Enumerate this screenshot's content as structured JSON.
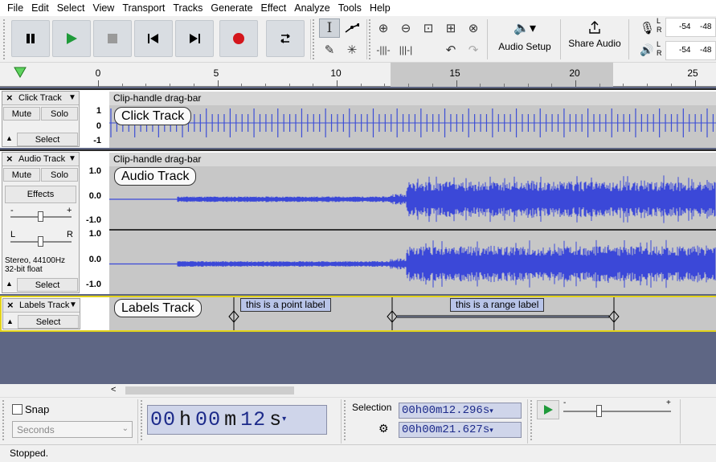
{
  "menu": [
    "File",
    "Edit",
    "Select",
    "View",
    "Transport",
    "Tracks",
    "Generate",
    "Effect",
    "Analyze",
    "Tools",
    "Help"
  ],
  "toolbar": {
    "audio_setup": "Audio Setup",
    "share_audio": "Share Audio",
    "meter_rec": {
      "left": "L",
      "right": "R",
      "val1": "-54",
      "val2": "-48"
    },
    "meter_play": {
      "left": "L",
      "right": "R",
      "val1": "-54",
      "val2": "-48"
    }
  },
  "ruler": {
    "ticks": [
      "0",
      "5",
      "10",
      "15",
      "20",
      "25"
    ]
  },
  "tracks": {
    "click": {
      "name": "Click Track",
      "mute": "Mute",
      "solo": "Solo",
      "select": "Select",
      "clip_title": "Clip-handle drag-bar",
      "label": "Click Track",
      "scale": [
        "1",
        "0",
        "-1"
      ]
    },
    "audio": {
      "name": "Audio Track",
      "mute": "Mute",
      "solo": "Solo",
      "effects": "Effects",
      "select": "Select",
      "clip_title": "Clip-handle drag-bar",
      "label": "Audio Track",
      "info1": "Stereo, 44100Hz",
      "info2": "32-bit float",
      "pan_l": "L",
      "pan_r": "R",
      "gain_minus": "-",
      "gain_plus": "+",
      "scale": [
        "1.0",
        "0.0",
        "-1.0"
      ]
    },
    "labels": {
      "name": "Labels Track",
      "select": "Select",
      "label": "Labels Track",
      "point_label": "this is a point label",
      "range_label": "this is a range label"
    }
  },
  "bottom": {
    "snap": "Snap",
    "snap_unit": "Seconds",
    "time": {
      "h1": "0",
      "h2": "0",
      "h": "h",
      "m1": "0",
      "m2": "0",
      "m": "m",
      "s1": "1",
      "s2": "2",
      "s": "s"
    },
    "selection": "Selection",
    "sel_start": "00h00m12.296s",
    "sel_end": "00h00m21.627s",
    "speed_minus": "-",
    "speed_plus": "+"
  },
  "status": "Stopped."
}
